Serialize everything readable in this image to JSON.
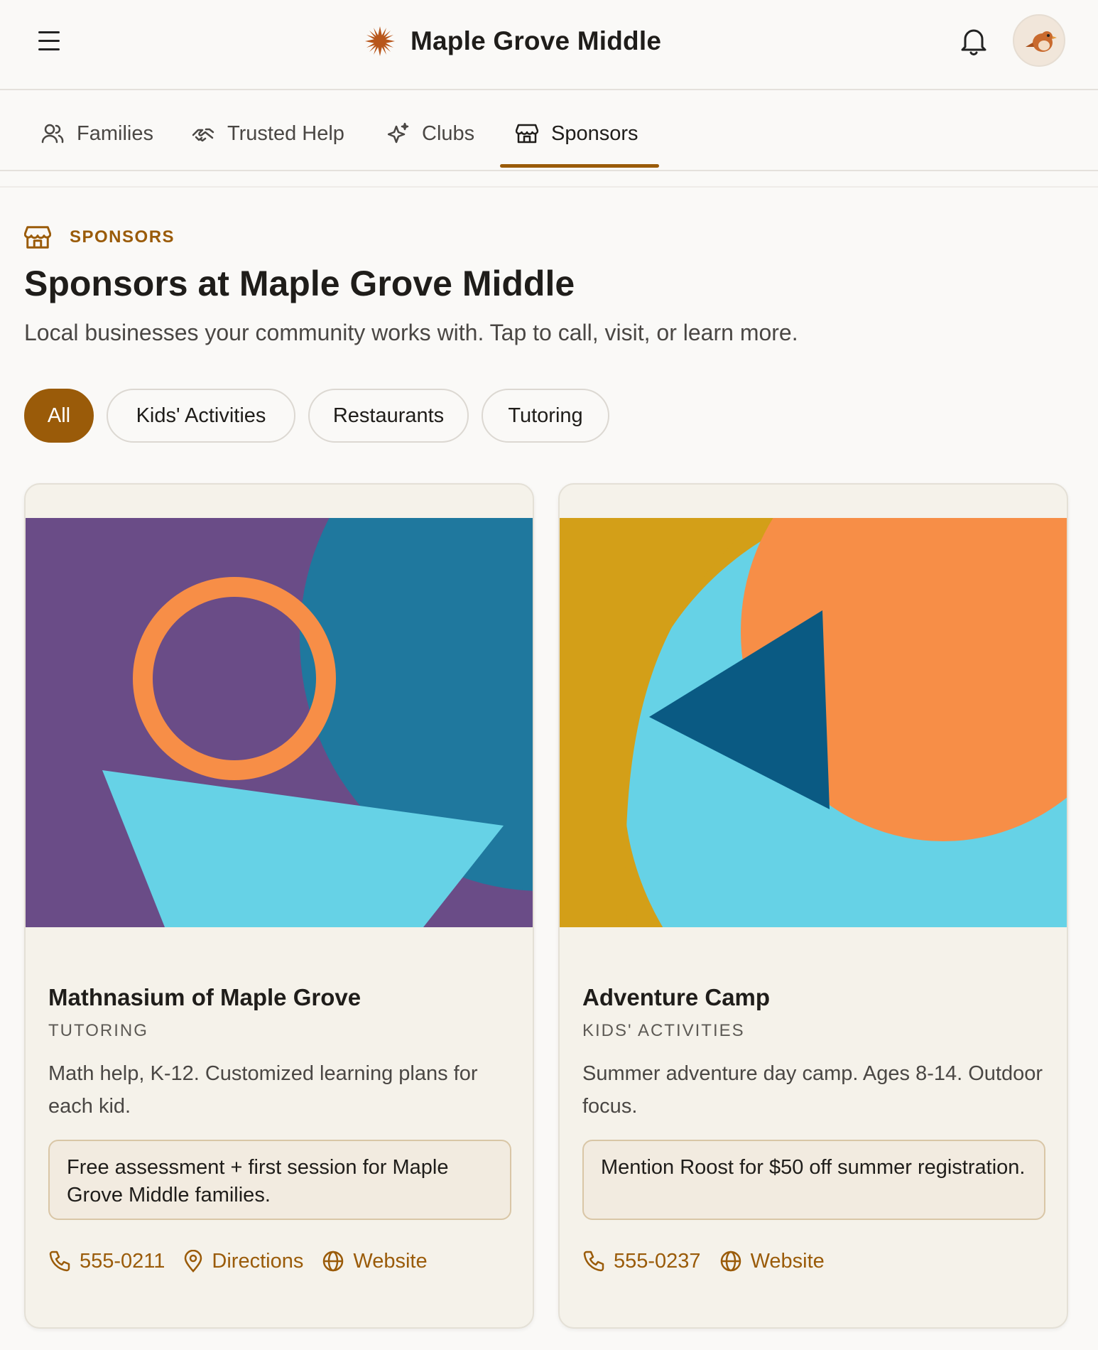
{
  "app": {
    "title": "Maple Grove Middle"
  },
  "nav": {
    "tabs": [
      {
        "label": "Families",
        "icon": "users-icon",
        "active": false
      },
      {
        "label": "Trusted Help",
        "icon": "handshake-icon",
        "active": false
      },
      {
        "label": "Clubs",
        "icon": "sparkles-icon",
        "active": false
      },
      {
        "label": "Sponsors",
        "icon": "store-icon",
        "active": true
      }
    ]
  },
  "section": {
    "eyebrow": "SPONSORS",
    "title": "Sponsors at Maple Grove Middle",
    "subtitle": "Local businesses your community works with. Tap to call, visit, or learn more."
  },
  "filters": [
    {
      "label": "All",
      "active": true
    },
    {
      "label": "Kids' Activities",
      "active": false
    },
    {
      "label": "Restaurants",
      "active": false
    },
    {
      "label": "Tutoring",
      "active": false
    }
  ],
  "sponsors": [
    {
      "name": "Mathnasium of Maple Grove",
      "category": "TUTORING",
      "description": "Math help, K-12. Customized learning plans for each kid.",
      "offer": "Free assessment + first session for Maple Grove Middle families.",
      "phone": "555-0211",
      "directions_label": "Directions",
      "website_label": "Website"
    },
    {
      "name": "Adventure Camp",
      "category": "KIDS' ACTIVITIES",
      "description": "Summer adventure day camp. Ages 8-14. Outdoor focus.",
      "offer": "Mention Roost for $50 off summer registration.",
      "phone": "555-0237",
      "website_label": "Website"
    }
  ],
  "colors": {
    "accent": "#9a5b09",
    "background": "#faf9f7",
    "card": "#f5f2ea",
    "art_purple": "#6a4c87",
    "art_blue": "#1f789e",
    "art_orange": "#f78e47",
    "art_cyan": "#66d2e6",
    "art_gold": "#d39f18",
    "art_navy": "#0a5a83"
  }
}
